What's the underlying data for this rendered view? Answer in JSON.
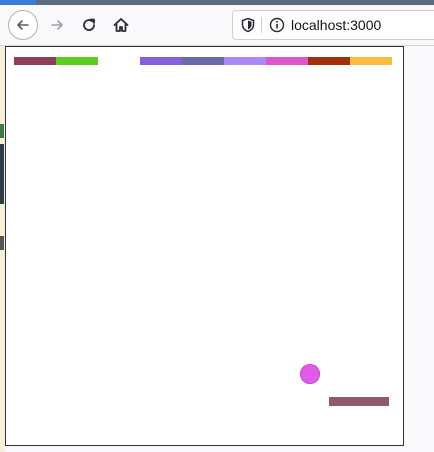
{
  "browser": {
    "url": "localhost:3000",
    "icons": {
      "back": "arrow-left-icon",
      "forward": "arrow-right-icon",
      "reload": "reload-icon",
      "home": "home-icon",
      "shield": "shield-icon",
      "info": "info-icon"
    }
  },
  "game": {
    "bricks": [
      {
        "color": "#8e3f5e"
      },
      {
        "color": "#5ccd1e"
      },
      {
        "color": null
      },
      {
        "color": "#8660db"
      },
      {
        "color": "#6a6aa6"
      },
      {
        "color": "#a98af7"
      },
      {
        "color": "#dc58c8"
      },
      {
        "color": "#a0300a"
      },
      {
        "color": "#fcbc3c"
      }
    ],
    "ball_color": "#e15ce6",
    "paddle_color": "#8c5a6a"
  }
}
